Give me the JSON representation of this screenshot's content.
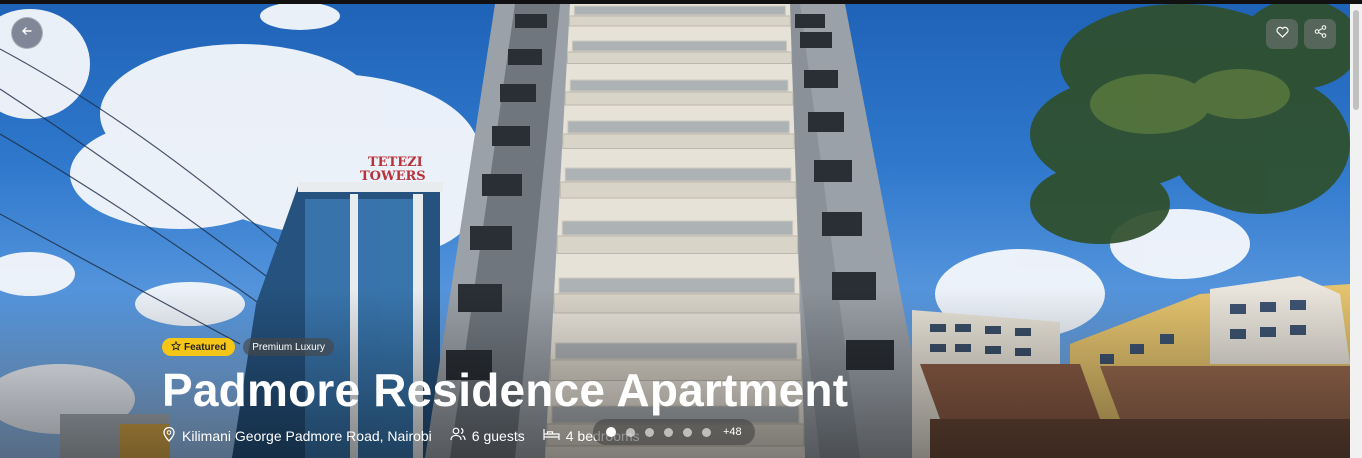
{
  "hero": {
    "back_icon": "arrow-left-icon",
    "favorite_icon": "heart-icon",
    "share_icon": "share-icon",
    "building_sign": [
      "TETEZI",
      "TOWERS"
    ]
  },
  "badges": {
    "featured": "Featured",
    "featured_icon": "star-icon",
    "premium": "Premium Luxury"
  },
  "listing": {
    "title": "Padmore Residence Apartment",
    "location": "Kilimani George Padmore Road, Nairobi",
    "guests": "6 guests",
    "bedrooms": "4 bedrooms"
  },
  "gallery": {
    "more_count": "+48",
    "active_index": 0,
    "dot_count": 6
  }
}
